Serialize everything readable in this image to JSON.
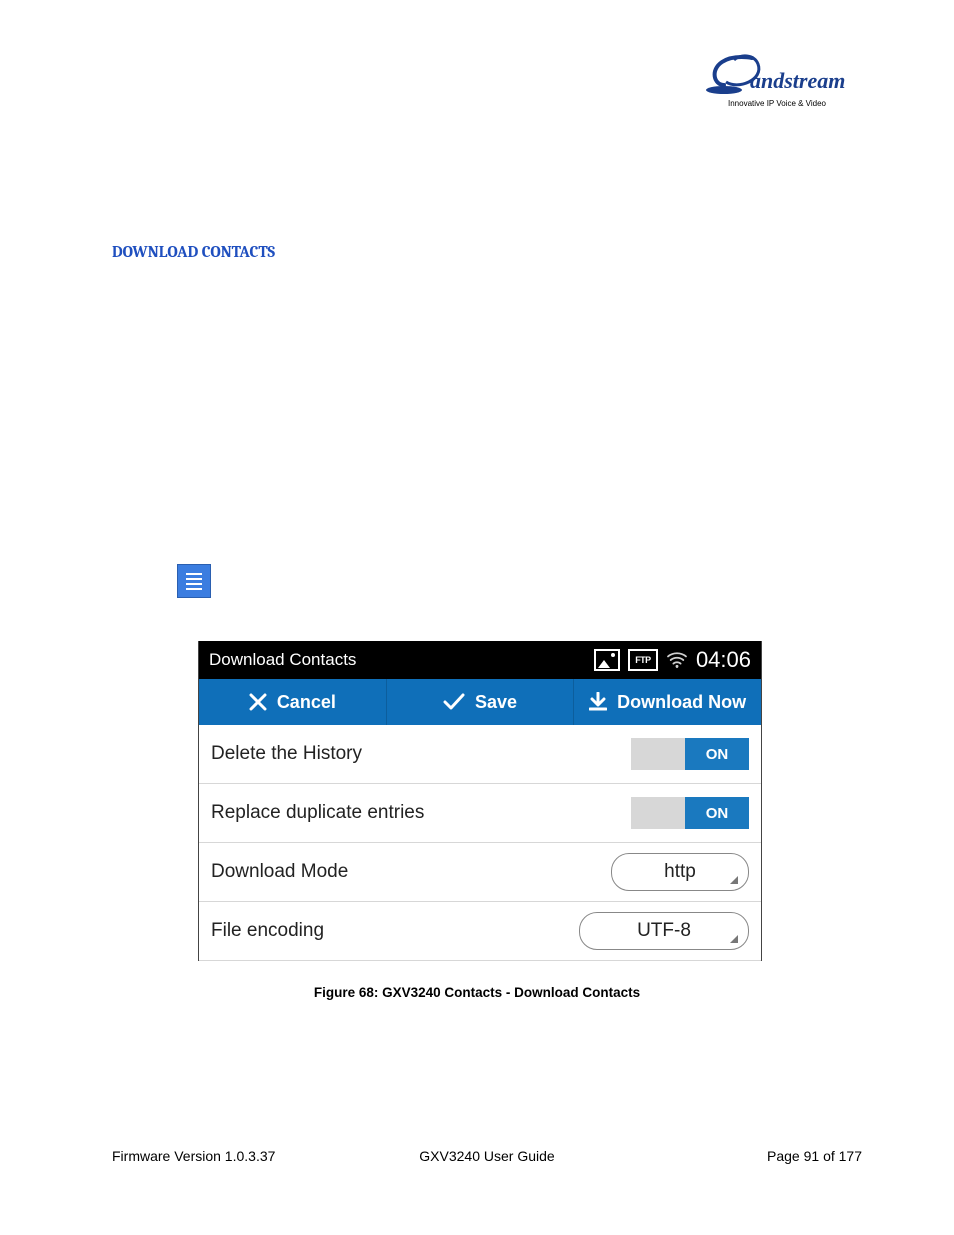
{
  "logo": {
    "brand": "Grandstream",
    "tagline": "Innovative IP Voice & Video"
  },
  "heading": "DOWNLOAD CONTACTS",
  "screenshot": {
    "status": {
      "title": "Download Contacts",
      "ftp_label": "FTP",
      "time": "04:06"
    },
    "toolbar": {
      "cancel": "Cancel",
      "save": "Save",
      "download": "Download Now"
    },
    "rows": {
      "delete_history": {
        "label": "Delete the History",
        "value": "ON"
      },
      "replace_dup": {
        "label": "Replace duplicate entries",
        "value": "ON"
      },
      "download_mode": {
        "label": "Download Mode",
        "value": "http"
      },
      "file_encoding": {
        "label": "File encoding",
        "value": "UTF-8"
      }
    }
  },
  "caption": "Figure 68: GXV3240 Contacts - Download Contacts",
  "footer": {
    "left": "Firmware Version 1.0.3.37",
    "center": "GXV3240 User Guide",
    "right": "Page 91 of 177"
  }
}
